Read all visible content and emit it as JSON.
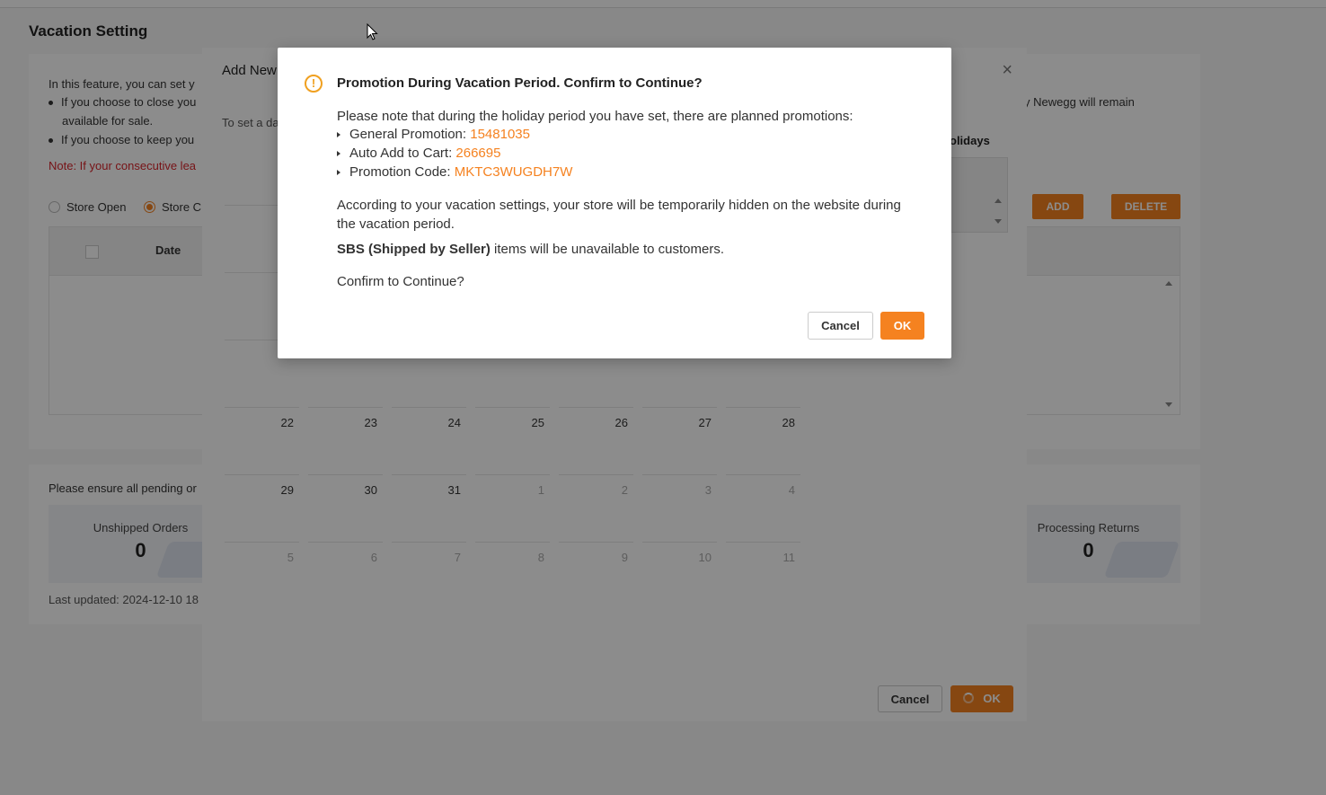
{
  "page": {
    "title": "Vacation Setting",
    "intro": "In this feature, you can set y",
    "bullet1_line1": "If you choose to close you",
    "bullet1_line2": "available for sale.",
    "bullet2": "If you choose to keep you",
    "note": "Note: If your consecutive lea",
    "right_text": "y Newegg will remain",
    "radio_open": "Store Open",
    "radio_closed": "Store C",
    "add_button": "ADD",
    "delete_button": "DELETE",
    "col_date": "Date",
    "ensure_text": "Please ensure all pending or",
    "stat_unshipped_label": "Unshipped Orders",
    "stat_unshipped_value": "0",
    "stat_returns_label": "Processing Returns",
    "stat_returns_value": "0",
    "last_updated": "Last updated: 2024-12-10 18"
  },
  "add_modal": {
    "title": "Add New",
    "subtitle": "To set a da",
    "holidays_label": "olidays",
    "calendar_rows": [
      [
        {
          "d": "22",
          "o": false
        },
        {
          "d": "23",
          "o": false
        },
        {
          "d": "24",
          "o": false
        },
        {
          "d": "25",
          "o": false
        },
        {
          "d": "26",
          "o": false
        },
        {
          "d": "27",
          "o": false
        },
        {
          "d": "28",
          "o": false
        }
      ],
      [
        {
          "d": "29",
          "o": false
        },
        {
          "d": "30",
          "o": false
        },
        {
          "d": "31",
          "o": false
        },
        {
          "d": "1",
          "o": true
        },
        {
          "d": "2",
          "o": true
        },
        {
          "d": "3",
          "o": true
        },
        {
          "d": "4",
          "o": true
        }
      ],
      [
        {
          "d": "5",
          "o": true
        },
        {
          "d": "6",
          "o": true
        },
        {
          "d": "7",
          "o": true
        },
        {
          "d": "8",
          "o": true
        },
        {
          "d": "9",
          "o": true
        },
        {
          "d": "10",
          "o": true
        },
        {
          "d": "11",
          "o": true
        }
      ]
    ],
    "cancel_label": "Cancel",
    "ok_label": "OK"
  },
  "dialog": {
    "title": "Promotion During Vacation Period. Confirm to Continue?",
    "intro": "Please note that during the holiday period you have set, there are planned promotions:",
    "items": [
      {
        "label": "General Promotion: ",
        "value": "15481035"
      },
      {
        "label": "Auto Add to Cart: ",
        "value": "266695"
      },
      {
        "label": "Promotion Code: ",
        "value": "MKTC3WUGDH7W"
      }
    ],
    "settings_text": "According to your vacation settings, your store will be temporarily hidden on the website during the vacation period.",
    "sbs_bold": "SBS (Shipped by Seller)",
    "sbs_rest": " items will be unavailable to customers.",
    "confirm_text": "Confirm to Continue?",
    "cancel_label": "Cancel",
    "ok_label": "OK"
  },
  "colors": {
    "accent": "#f58220",
    "warning": "#f0a020",
    "note_red": "#d9262c"
  }
}
